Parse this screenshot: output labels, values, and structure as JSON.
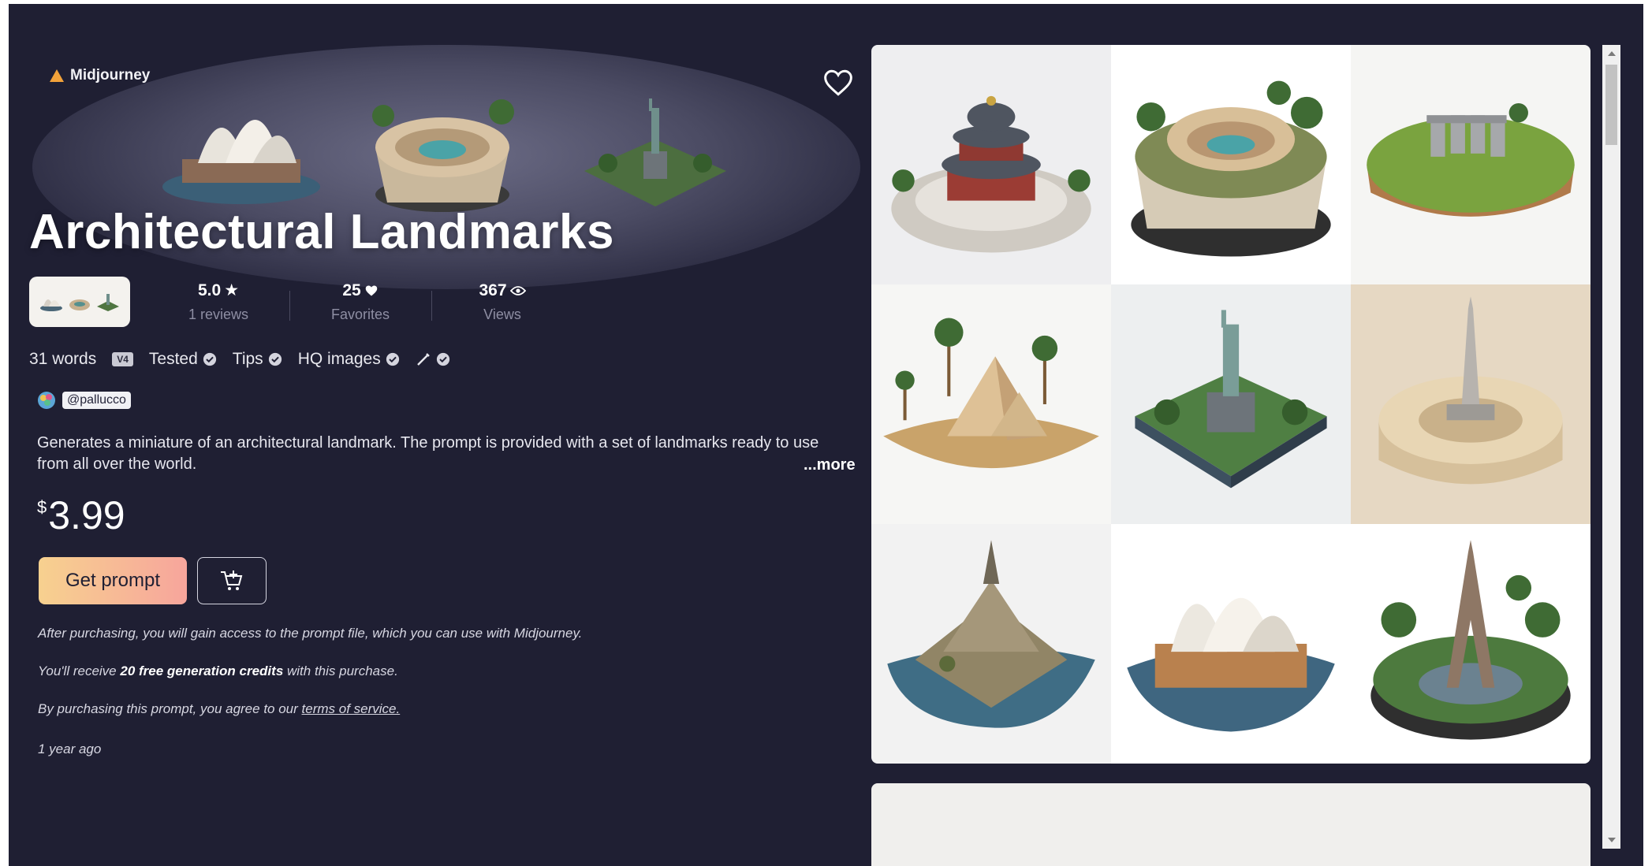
{
  "product": {
    "platform": "Midjourney",
    "title": "Architectural Landmarks",
    "stats": {
      "rating": "5.0",
      "rating_label": "1 reviews",
      "favorites": "25",
      "favorites_label": "Favorites",
      "views": "367",
      "views_label": "Views"
    },
    "meta": {
      "words": "31 words",
      "version": "V4",
      "tested": "Tested",
      "tips": "Tips",
      "hq": "HQ images"
    },
    "author": "@pallucco",
    "description": "Generates a miniature of an architectural landmark. The prompt is provided with a set of landmarks ready to use from all over the world.",
    "more": "...more",
    "price_currency": "$",
    "price_value": "3.99",
    "cta": "Get prompt",
    "notes": {
      "access": "After purchasing, you will gain access to the prompt file, which you can use with Midjourney.",
      "credits_prefix": "You'll receive ",
      "credits_bold": "20 free generation credits",
      "credits_suffix": " with this purchase.",
      "terms_prefix": "By purchasing this prompt, you agree to our ",
      "terms_link": "terms of service.",
      "age": "1 year ago"
    }
  },
  "gallery": [
    "temple-of-heaven",
    "colosseum",
    "stonehenge",
    "pyramids",
    "statue-of-liberty",
    "burj-khalifa",
    "mont-saint-michel",
    "sydney-opera-house",
    "eiffel-tower"
  ],
  "colors": {
    "background": "#1f1f33",
    "cta_gradient_start": "#f7d18f",
    "cta_gradient_end": "#f7a59c"
  }
}
